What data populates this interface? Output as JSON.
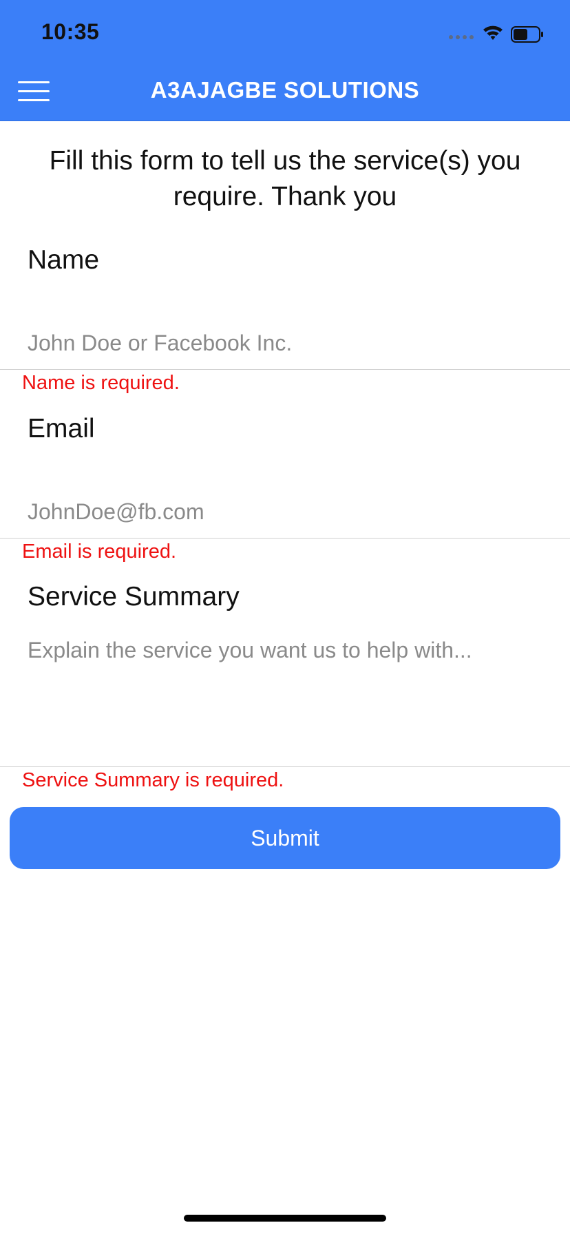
{
  "status_bar": {
    "time": "10:35"
  },
  "header": {
    "title": "A3AJAGBE SOLUTIONS",
    "menu_icon": "hamburger-menu-icon",
    "background_color": "#3b7ff8"
  },
  "form": {
    "intro": "Fill this form to tell us the service(s) you require. Thank you",
    "name": {
      "label": "Name",
      "value": "",
      "placeholder": "John Doe or Facebook Inc.",
      "error": "Name is required."
    },
    "email": {
      "label": "Email",
      "value": "",
      "placeholder": "JohnDoe@fb.com",
      "error": "Email is required."
    },
    "service_summary": {
      "label": "Service Summary",
      "value": "",
      "placeholder": "Explain the service you want us to help with...",
      "error": "Service Summary is required."
    },
    "submit_label": "Submit"
  },
  "colors": {
    "accent": "#3b7ff8",
    "error": "#ee1111"
  }
}
